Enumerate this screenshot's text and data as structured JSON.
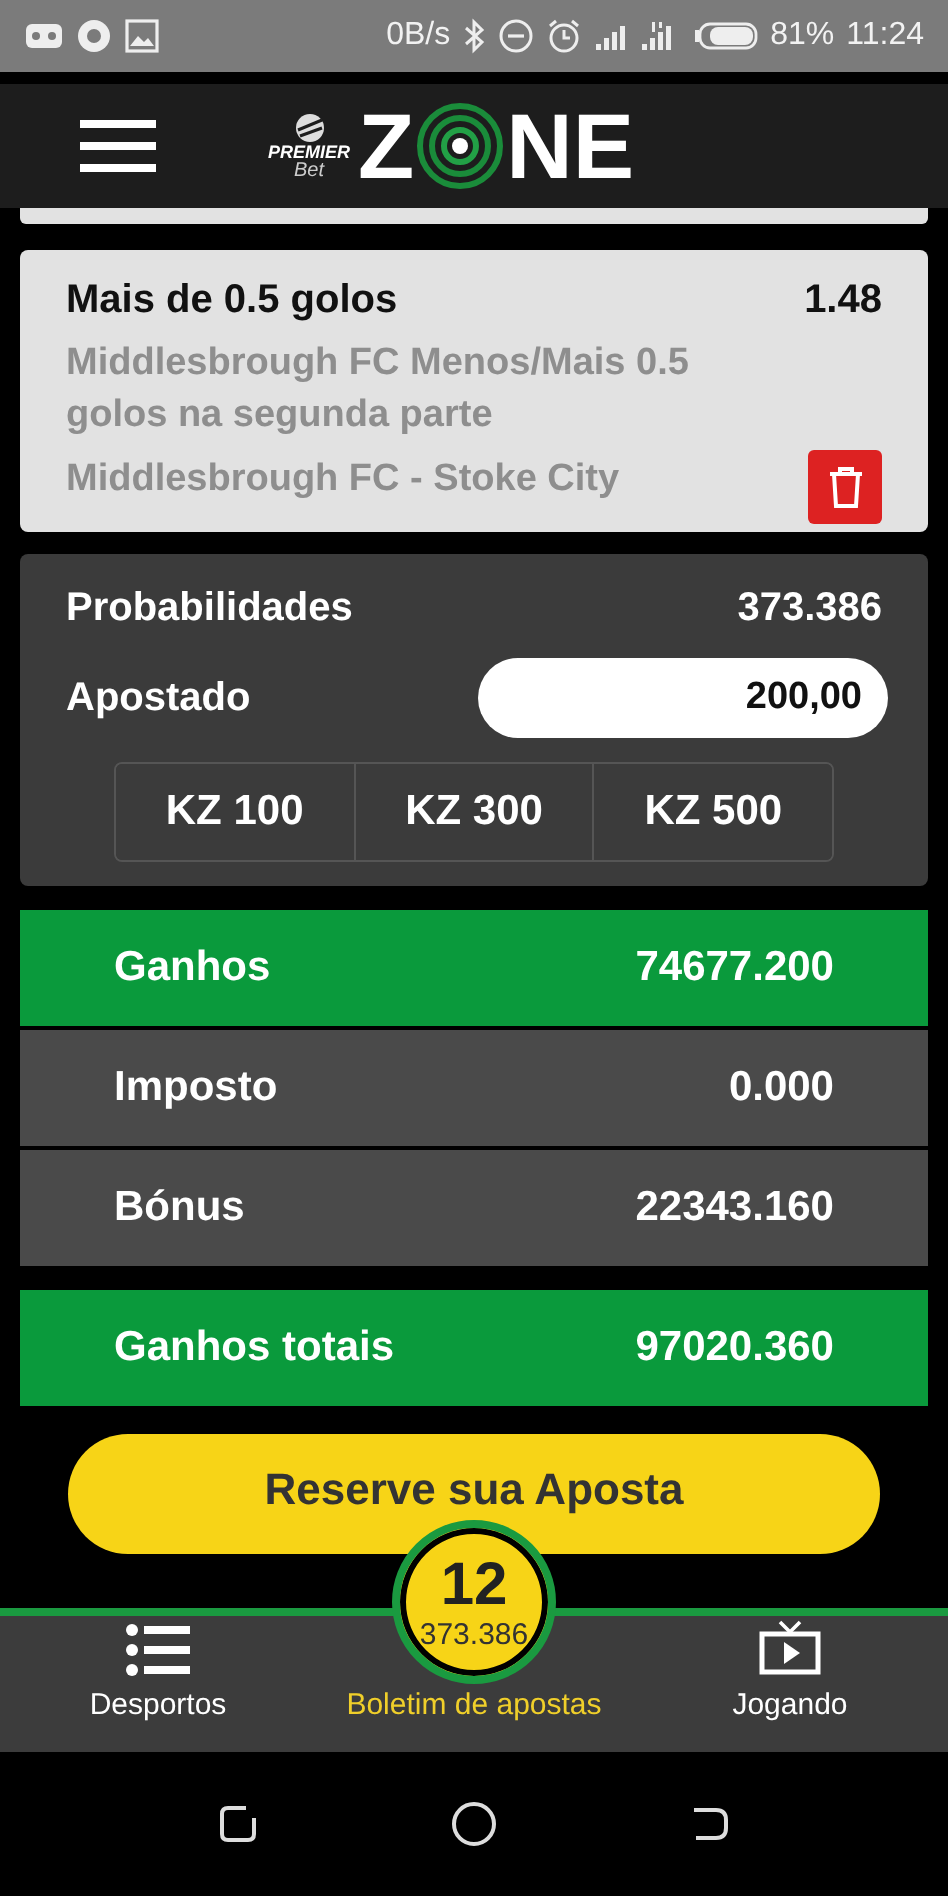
{
  "status_bar": {
    "speed": "0B/s",
    "battery": "81%",
    "time": "11:24"
  },
  "header": {
    "logo": {
      "brand_top": "PREMIER",
      "brand_bottom": "Bet",
      "word_start": "Z",
      "word_end": "NE"
    }
  },
  "bet": {
    "selection": "Mais de 0.5 golos",
    "odds": "1.48",
    "market": "Middlesbrough FC Menos/Mais 0.5 golos na segunda parte",
    "match": "Middlesbrough FC - Stoke City"
  },
  "slip": {
    "odds_label": "Probabilidades",
    "odds_value": "373.386",
    "stake_label": "Apostado",
    "stake_value": "200,00",
    "quick_amounts": [
      {
        "label": "KZ 100",
        "selected": false
      },
      {
        "label": "KZ 300",
        "selected": false
      },
      {
        "label": "KZ 500",
        "selected": false
      }
    ]
  },
  "summary": [
    {
      "label": "Ganhos",
      "value": "74677.200",
      "kind": "highlight"
    },
    {
      "label": "Imposto",
      "value": "0.000",
      "kind": "plain"
    },
    {
      "label": "Bónus",
      "value": "22343.160",
      "kind": "plain"
    },
    {
      "label": "Ganhos totais",
      "value": "97020.360",
      "kind": "total"
    }
  ],
  "reserve_button": "Reserve sua Aposta",
  "slip_badge": {
    "count": "12",
    "odds": "373.386"
  },
  "bottom_nav": [
    {
      "label": "Desportos",
      "kind": "list",
      "selected": false
    },
    {
      "label": "Boletim de apostas",
      "kind": "plain",
      "selected": true
    },
    {
      "label": "Jogando",
      "kind": "tv",
      "selected": false
    }
  ]
}
